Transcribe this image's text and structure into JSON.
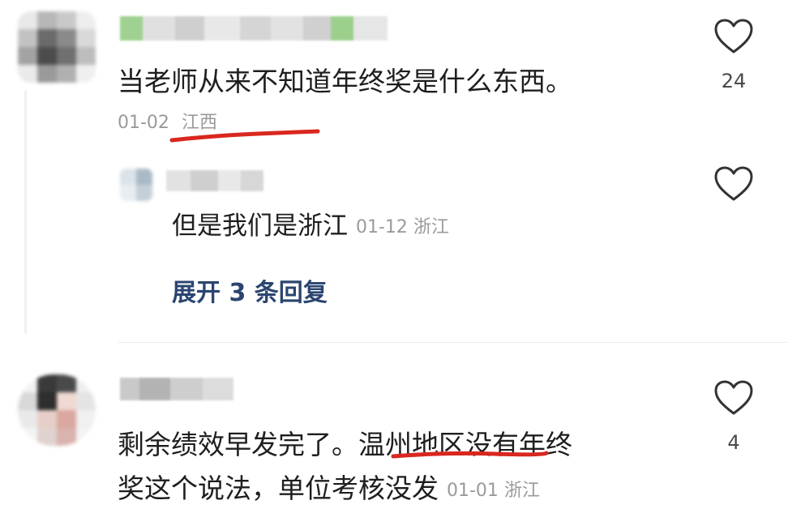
{
  "comments": [
    {
      "text": "当老师从来不知道年终奖是什么东西。",
      "date": "01-02",
      "location": "江西",
      "like_count": "24",
      "reply": {
        "text": "但是我们是浙江",
        "date": "01-12",
        "location": "浙江"
      },
      "expand_label": "展开 3 条回复"
    },
    {
      "text_line1_a": "剩余绩效早发完了。",
      "text_line1_b": "温州地区没",
      "text_line1_c": "有年终",
      "text_line2": "奖这个说法，单位考核没发",
      "date": "01-01",
      "location": "浙江",
      "like_count": "4"
    }
  ],
  "colors": {
    "annotation_red": "#d9271f",
    "expand_link": "#2b4570",
    "meta_gray": "#9a9a9a"
  },
  "icons": {
    "like": "heart-outline-icon"
  }
}
